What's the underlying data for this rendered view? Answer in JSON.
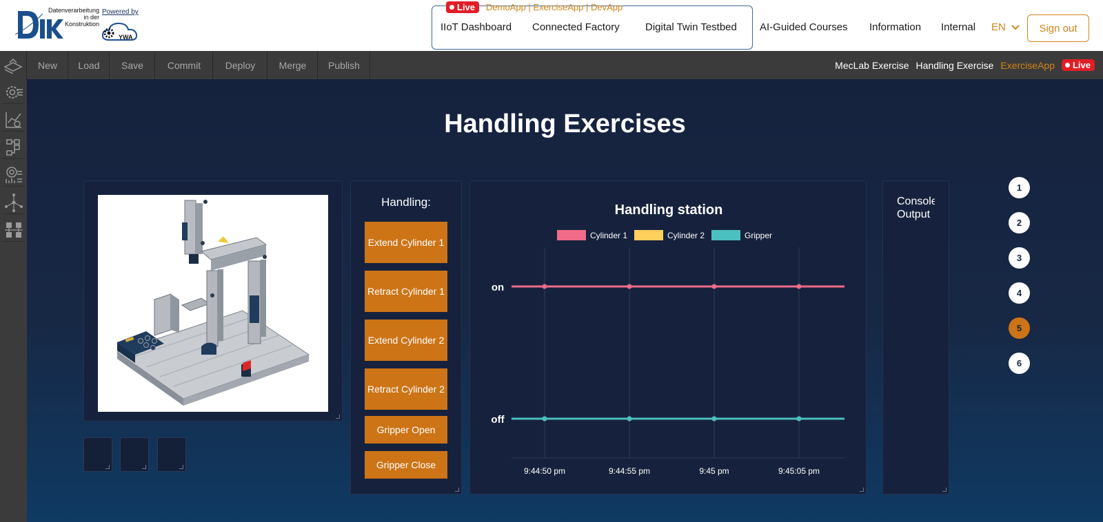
{
  "header": {
    "logo_lines": [
      "Datenverarbeitung",
      "in der",
      "Konstruktion"
    ],
    "powered_by": "Powered by",
    "ywa_text": "YWA",
    "live_label": "Live",
    "apps_link": "DemoApp | ExerciseApp | DevApp",
    "nav_boxed": [
      "IIoT Dashboard",
      "Connected Factory",
      "Digital Twin Testbed"
    ],
    "nav_other": [
      "AI-Guided Courses",
      "Information",
      "Internal"
    ],
    "language": "EN",
    "sign_out": "Sign out"
  },
  "toolbar": {
    "buttons": [
      "New",
      "Load",
      "Save",
      "Commit",
      "Deploy",
      "Merge",
      "Publish"
    ],
    "breadcrumbs": [
      "MecLab Exercise",
      "Handling Exercise",
      "ExerciseApp"
    ],
    "live_label": "Live"
  },
  "sidebar": {
    "icons": [
      "gear-chip-icon",
      "chart-settings-icon",
      "flowchart-icon",
      "dashboard-settings-icon",
      "network-icon",
      "hierarchy-icon"
    ]
  },
  "main": {
    "title": "Handling Exercises",
    "handling_label": "Handling:",
    "buttons": [
      "Extend Cylinder 1",
      "Retract Cylinder 1",
      "Extend Cylinder 2",
      "Retract Cylinder 2",
      "Gripper Open",
      "Gripper Close"
    ],
    "console_label": "Console Output",
    "steps": [
      "1",
      "2",
      "3",
      "4",
      "5",
      "6"
    ],
    "active_step": "5"
  },
  "chart_data": {
    "type": "line",
    "title": "Handling station",
    "x": [
      "9:44:50 pm",
      "9:44:55 pm",
      "9:45 pm",
      "9:45:05 pm"
    ],
    "y_categories": [
      "off",
      "on"
    ],
    "series": [
      {
        "name": "Cylinder 1",
        "color": "#f06b88",
        "values": [
          "on",
          "on",
          "on",
          "on"
        ]
      },
      {
        "name": "Cylinder 2",
        "color": "#ffd05c",
        "values": [
          "off",
          "off",
          "off",
          "off"
        ]
      },
      {
        "name": "Gripper",
        "color": "#4bc0c0",
        "values": [
          "off",
          "off",
          "off",
          "off"
        ]
      }
    ],
    "legend": "top",
    "grid": true
  },
  "colors": {
    "accent": "#cd7416",
    "live": "#e21d26",
    "background": "#15223e"
  }
}
